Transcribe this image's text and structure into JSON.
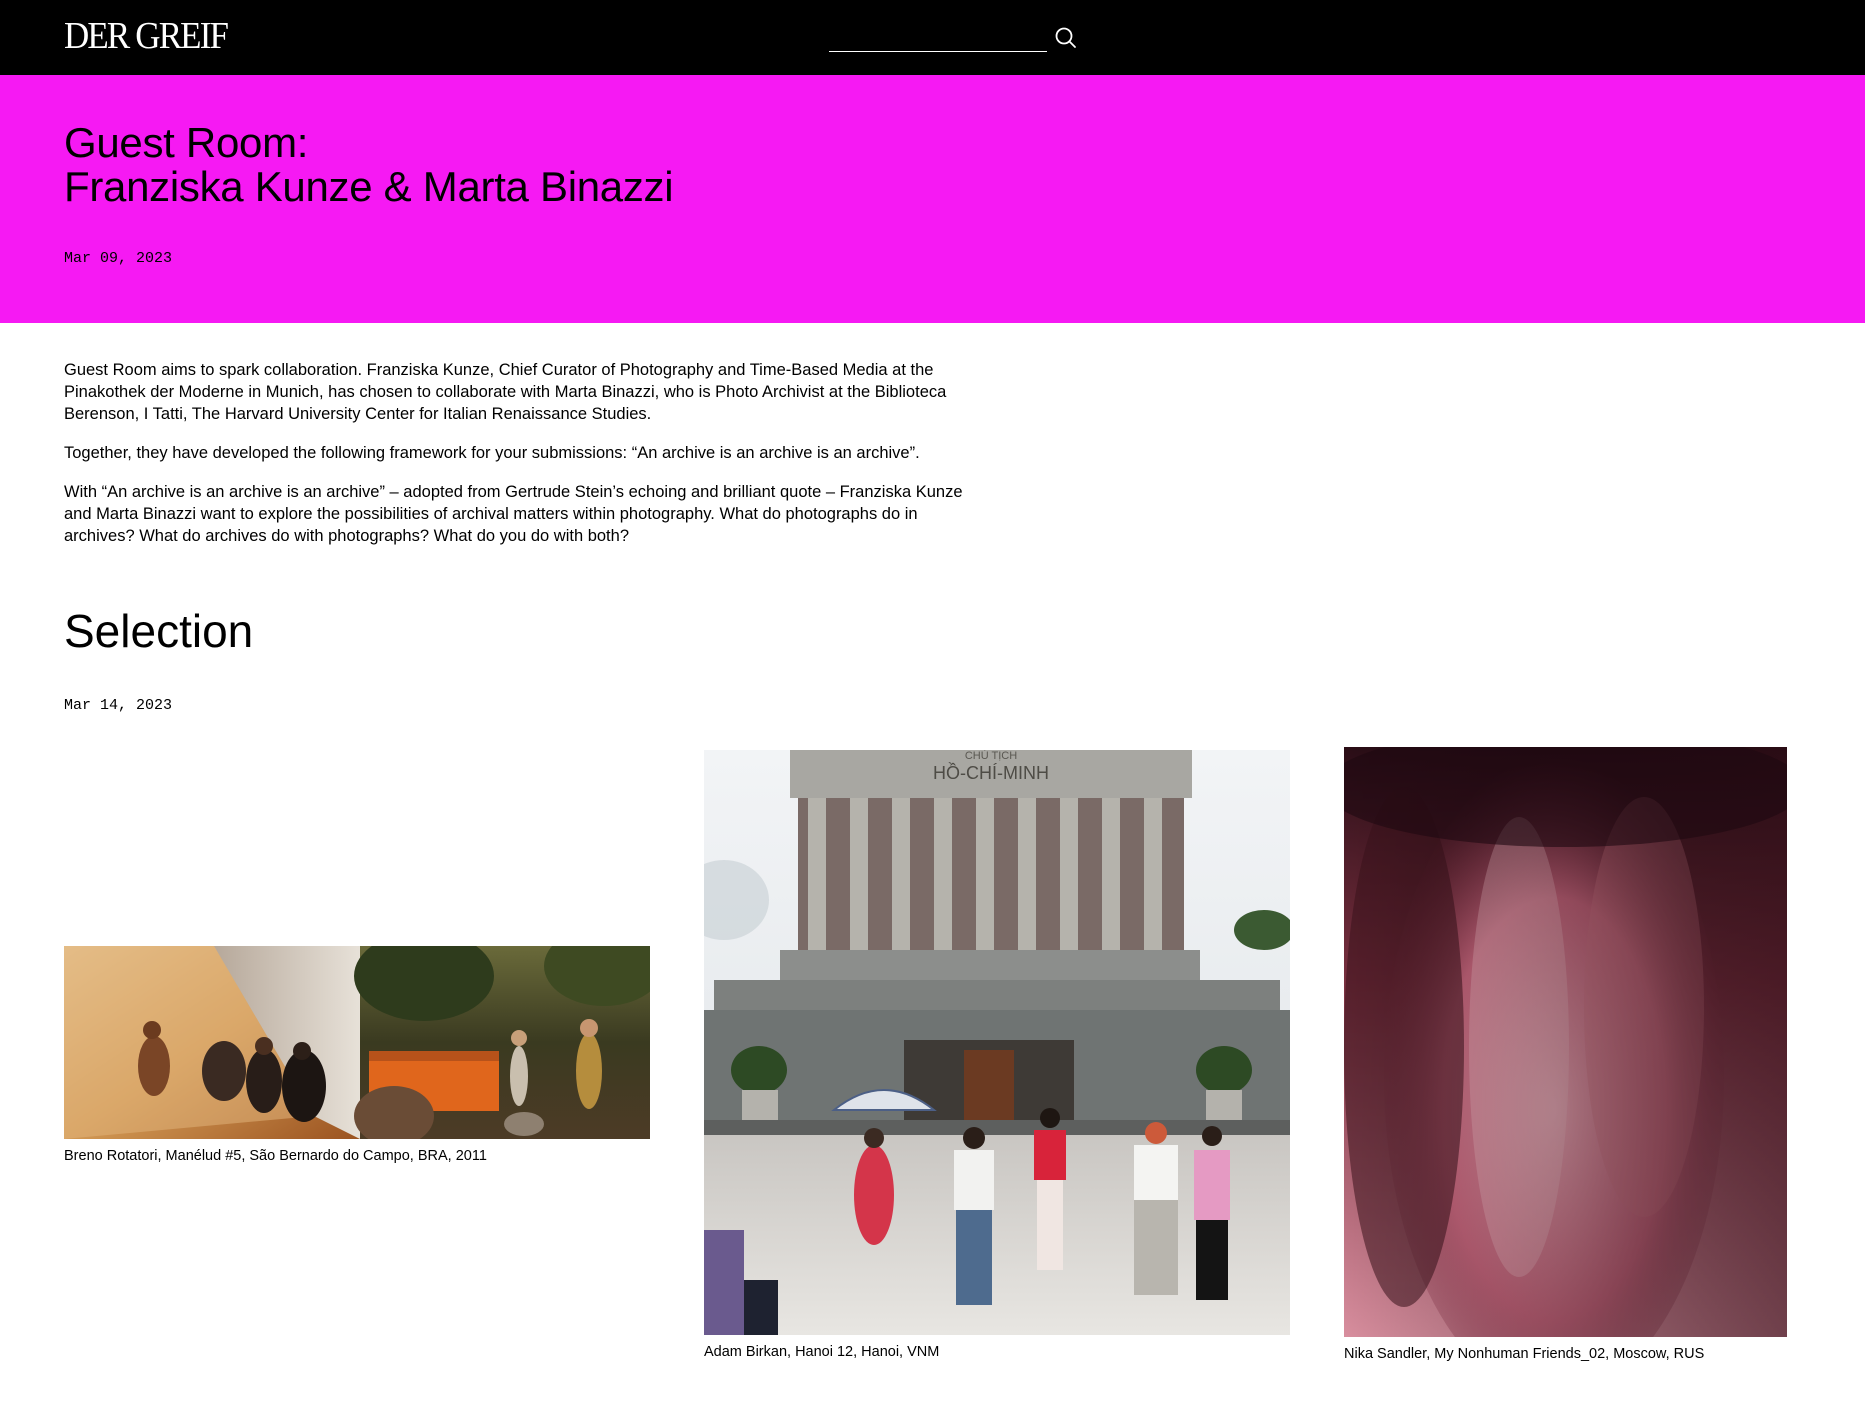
{
  "header": {
    "logo": "DER GREIF",
    "search": {
      "value": "",
      "placeholder": ""
    },
    "search_icon": "search-icon"
  },
  "hero": {
    "title_line1": "Guest Room:",
    "title_line2": "Franziska Kunze & Marta Binazzi",
    "date": "Mar 09, 2023",
    "background": "#f619f3"
  },
  "intro": {
    "paragraphs": [
      "Guest Room aims to spark collaboration. Franziska Kunze, Chief Curator of Photography and Time-Based Media at the Pinakothek der Moderne in Munich, has chosen to collaborate with Marta Binazzi, who is Photo Archivist at the Biblioteca Berenson, I Tatti, The Harvard University Center for Italian Renaissance Studies.",
      "Together, they have developed the following framework for your submissions: “An archive is an archive is an archive”.",
      "With “An archive is an archive is an archive” – adopted from Gertrude Stein’s echoing and brilliant quote – Franziska Kunze and Marta Binazzi want to explore the possibilities of archival matters within photography. What do photographs do in archives? What do archives do with photographs? What do you do with both?"
    ]
  },
  "selection": {
    "title": "Selection",
    "date": "Mar 14, 2023",
    "photos": [
      {
        "caption": "Breno Rotatori, Manélud #5, São Bernardo do Campo, BRA, 2011"
      },
      {
        "caption": "Adam Birkan, Hanoi 12, Hanoi, VNM",
        "sign_line1": "CHỦ TỊCH",
        "sign_line2": "HỒ-CHÍ-MINH"
      },
      {
        "caption": "Nika Sandler, My Nonhuman Friends_02, Moscow, RUS"
      }
    ]
  }
}
